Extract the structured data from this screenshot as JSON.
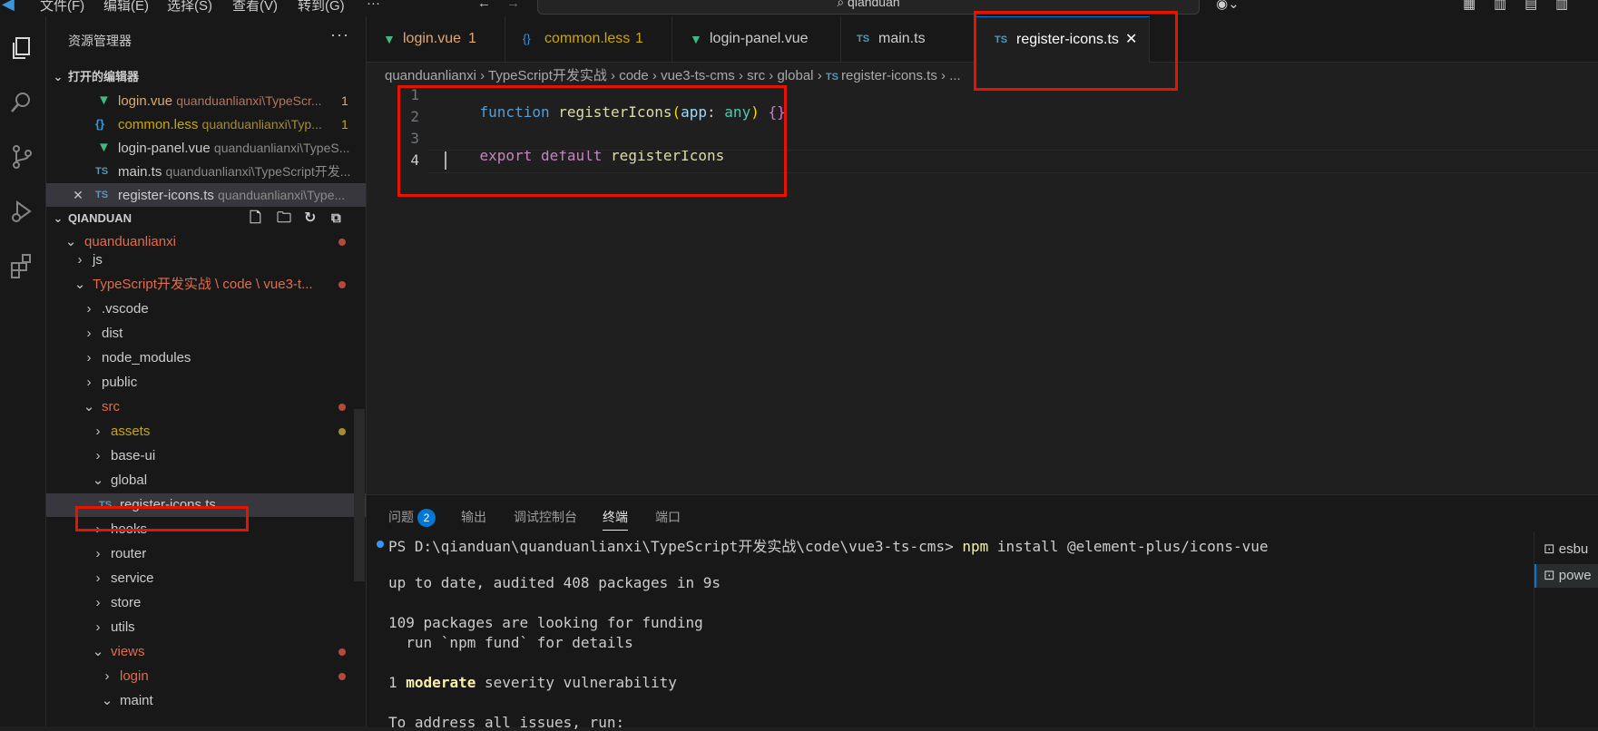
{
  "menu": [
    "文件(F)",
    "编辑(E)",
    "选择(S)",
    "查看(V)",
    "转到(G)",
    "···"
  ],
  "search": "qianduan",
  "sidebar": {
    "title": "资源管理器",
    "more": "···",
    "open_editors_title": "打开的编辑器",
    "open_editors": [
      {
        "name": "login.vue",
        "path": "quanduanlianxi\\TypeScr...",
        "badge": "1",
        "icon": "vue"
      },
      {
        "name": "common.less",
        "path": "quanduanlianxi\\Typ...",
        "badge": "1",
        "icon": "less"
      },
      {
        "name": "login-panel.vue",
        "path": "quanduanlianxi\\TypeS...",
        "badge": "",
        "icon": "vue"
      },
      {
        "name": "main.ts",
        "path": "quanduanlianxi\\TypeScript开发...",
        "badge": "",
        "icon": "ts"
      },
      {
        "name": "register-icons.ts",
        "path": "quanduanlianxi\\Type...",
        "badge": "",
        "icon": "ts"
      }
    ],
    "folder_title": "QIANDUAN",
    "tree": {
      "root": "quanduanlianxi",
      "js": "js",
      "project": "TypeScript开发实战 \\ code \\ vue3-t...",
      "vscode": ".vscode",
      "dist": "dist",
      "node_modules": "node_modules",
      "public": "public",
      "src": "src",
      "assets": "assets",
      "base_ui": "base-ui",
      "global": "global",
      "register_icons": "register-icons.ts",
      "hooks": "hooks",
      "router": "router",
      "service": "service",
      "store": "store",
      "utils": "utils",
      "views": "views",
      "login": "login",
      "maint": "maint"
    }
  },
  "tabs": [
    {
      "label": "login.vue",
      "badge": "1"
    },
    {
      "label": "common.less",
      "badge": "1"
    },
    {
      "label": "login-panel.vue",
      "badge": ""
    },
    {
      "label": "main.ts",
      "badge": ""
    },
    {
      "label": "register-icons.ts",
      "badge": ""
    }
  ],
  "breadcrumb": [
    "quanduanlianxi",
    "TypeScript开发实战",
    "code",
    "vue3-ts-cms",
    "src",
    "global",
    "register-icons.ts",
    "..."
  ],
  "code": {
    "line_numbers": [
      "1",
      "2",
      "3",
      "4"
    ],
    "line1": {
      "kw": "function",
      "fn": "registerIcons",
      "open": "(",
      "param": "app",
      "colon": ":",
      "type": "any",
      "close": ")",
      "body": "{}"
    },
    "line3": {
      "kw1": "export",
      "kw2": "default",
      "id": "registerIcons"
    }
  },
  "panel": {
    "tabs": [
      "问题",
      "输出",
      "调试控制台",
      "终端",
      "端口"
    ],
    "problems_count": "2",
    "terminal": {
      "prompt": "PS D:\\qianduan\\quanduanlianxi\\TypeScript开发实战\\code\\vue3-ts-cms>",
      "cmd": "npm",
      "args": "install @element-plus/icons-vue",
      "line2": "up to date, audited 408 packages in 9s",
      "line3": "109 packages are looking for funding",
      "line4": "  run `npm fund` for details",
      "line5_num": "1",
      "line5_kw": "moderate",
      "line5_rest": "severity vulnerability",
      "line6": "To address all issues, run:"
    },
    "terminals": [
      "esbu",
      "powe"
    ]
  },
  "colors": {
    "vue": "#41b883",
    "less": "#cbcb41",
    "ts": "#519aba",
    "git_modified": "#c74e39",
    "keyword": "#569cd6",
    "fn": "#dcdcaa",
    "param": "#9cdcfe",
    "type": "#4ec9b0",
    "control": "#c586c0",
    "bracket": "#ffd700",
    "highlight": "#e51400"
  }
}
